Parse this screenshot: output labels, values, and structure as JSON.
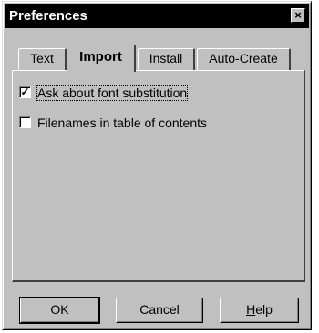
{
  "window": {
    "title": "Preferences",
    "close_glyph": "×"
  },
  "tabs": [
    {
      "label": "Text",
      "active": false
    },
    {
      "label": "Import",
      "active": true
    },
    {
      "label": "Install",
      "active": false
    },
    {
      "label": "Auto-Create",
      "active": false
    }
  ],
  "options": [
    {
      "label": "Ask about font substitution",
      "checked": true,
      "glyph": "✓"
    },
    {
      "label": "Filenames in table of contents",
      "checked": false,
      "glyph": ""
    }
  ],
  "buttons": {
    "ok": "OK",
    "cancel": "Cancel",
    "help": "Help"
  }
}
